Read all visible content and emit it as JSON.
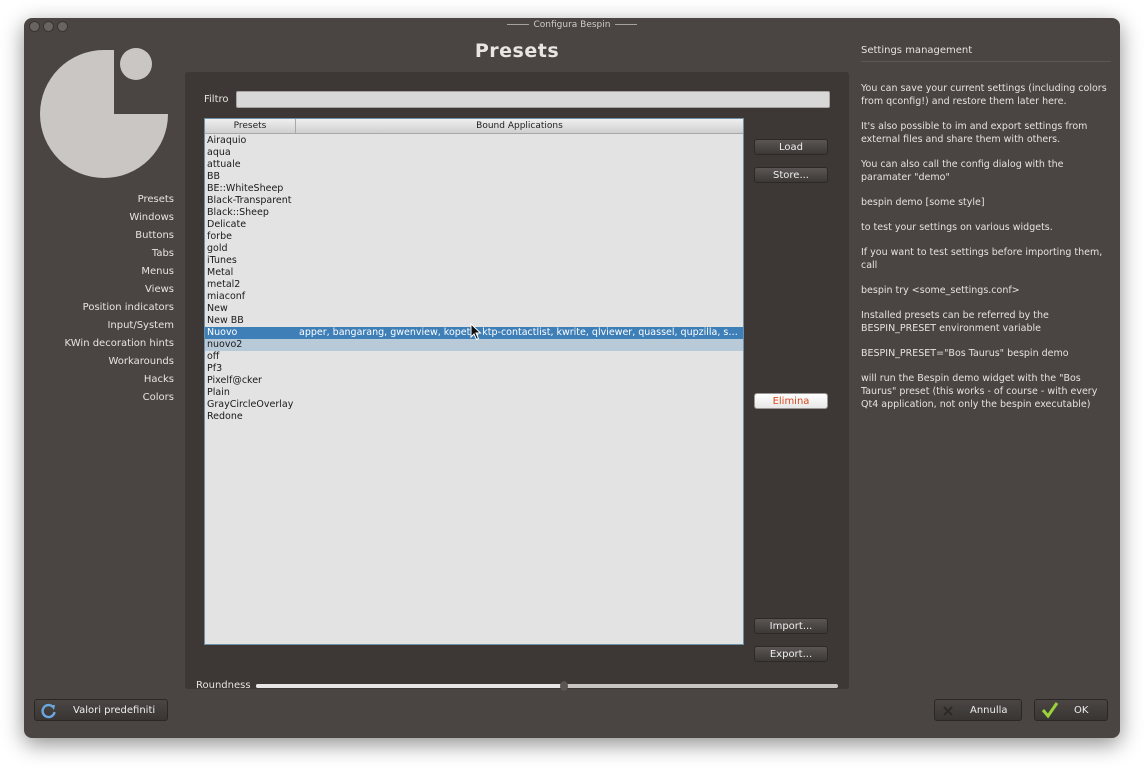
{
  "window": {
    "title": "Configura Bespin"
  },
  "nav": {
    "items": [
      "Presets",
      "Windows",
      "Buttons",
      "Tabs",
      "Menus",
      "Views",
      "Position indicators",
      "Input/System",
      "KWin decoration hints",
      "Workarounds",
      "Hacks",
      "Colors"
    ]
  },
  "panel": {
    "title": "Presets",
    "filter_label": "Filtro",
    "filter_value": "",
    "headers": {
      "presets": "Presets",
      "apps": "Bound Applications"
    },
    "rows": [
      {
        "name": "Airaquio",
        "apps": ""
      },
      {
        "name": "aqua",
        "apps": ""
      },
      {
        "name": "attuale",
        "apps": ""
      },
      {
        "name": "BB",
        "apps": ""
      },
      {
        "name": "BE::WhiteSheep",
        "apps": ""
      },
      {
        "name": "Black-Transparent",
        "apps": ""
      },
      {
        "name": "Black::Sheep",
        "apps": ""
      },
      {
        "name": "Delicate",
        "apps": ""
      },
      {
        "name": "forbe",
        "apps": ""
      },
      {
        "name": "gold",
        "apps": ""
      },
      {
        "name": "iTunes",
        "apps": ""
      },
      {
        "name": "Metal",
        "apps": ""
      },
      {
        "name": "metal2",
        "apps": ""
      },
      {
        "name": "miaconf",
        "apps": ""
      },
      {
        "name": "New",
        "apps": ""
      },
      {
        "name": "New BB",
        "apps": ""
      },
      {
        "name": "Nuovo",
        "apps": "apper, bangarang, gwenview, kopete, ktp-contactlist, kwrite, qlviewer, quassel, qupzilla, sm..."
      },
      {
        "name": "nuovo2",
        "apps": ""
      },
      {
        "name": "off",
        "apps": ""
      },
      {
        "name": "Pf3",
        "apps": ""
      },
      {
        "name": "Pixelf@cker",
        "apps": ""
      },
      {
        "name": "Plain",
        "apps": ""
      },
      {
        "name": "GrayCircleOverlay",
        "apps": ""
      },
      {
        "name": "Redone",
        "apps": ""
      }
    ],
    "selected_index": 16,
    "hover_index": 17,
    "buttons": {
      "load": "Load",
      "store": "Store...",
      "delete": "Elimina",
      "import": "Import...",
      "export": "Export..."
    },
    "roundness_label": "Roundness",
    "roundness_value": 0.53
  },
  "info": {
    "title": "Settings management",
    "paragraphs": [
      "You can save your current settings (including colors from qconfig!) and restore them later here.",
      "It's also possible to im and export settings from external files and share them with others.",
      "You can also call the config dialog with the paramater \"demo\"",
      "bespin demo [some style]",
      "to test your settings on various widgets.",
      "If you want to test settings before importing them, call",
      "bespin try <some_settings.conf>",
      "Installed presets can be referred by the BESPIN_PRESET environment variable",
      "BESPIN_PRESET=\"Bos Taurus\" bespin demo",
      "will run the Bespin demo widget with the \"Bos Taurus\" preset (this works - of course - with every Qt4 application, not only the bespin executable)"
    ]
  },
  "bottom": {
    "defaults": "Valori predefiniti",
    "cancel": "Annulla",
    "ok": "OK"
  },
  "colors": {
    "window_bg": "#4a4542",
    "panel_bg": "#3d3835",
    "selection": "#3e7fb8",
    "danger": "#d6491c"
  },
  "icons": [
    "close-icon",
    "minimize-icon",
    "maximize-icon",
    "bespin-logo",
    "reset-icon",
    "cancel-icon",
    "ok-check-icon",
    "mouse-cursor-icon"
  ]
}
